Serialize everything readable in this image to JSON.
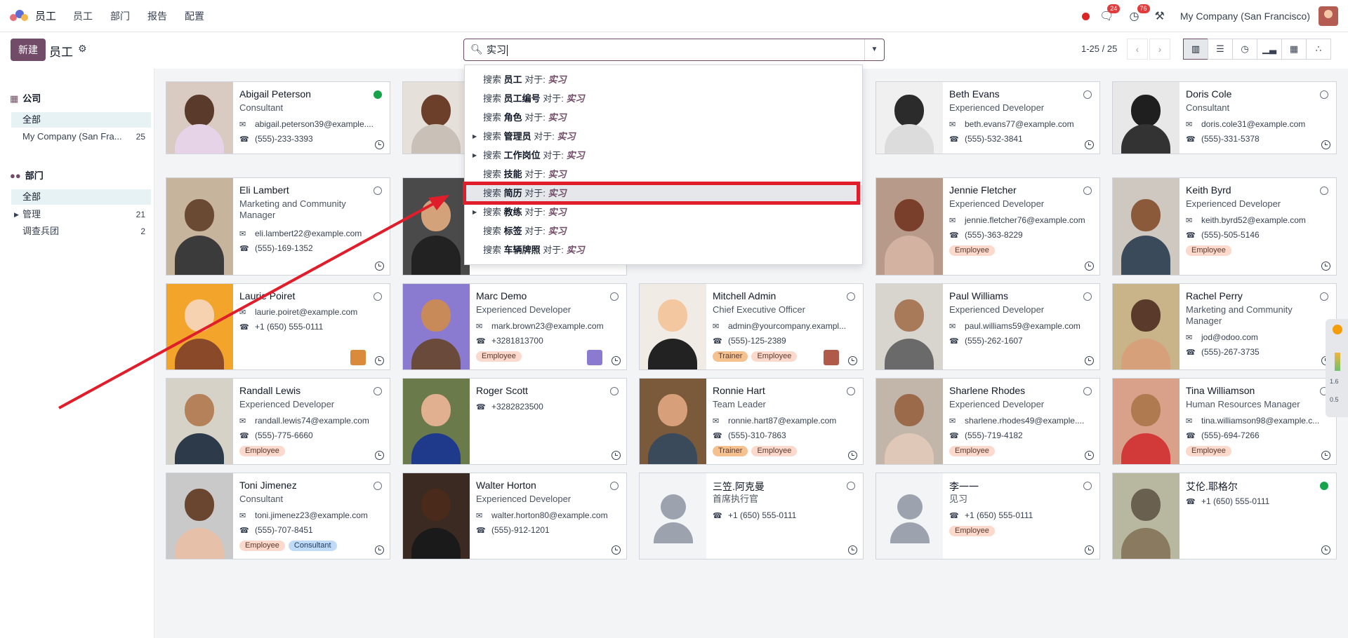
{
  "navbar": {
    "app_name": "员工",
    "menus": [
      "员工",
      "部门",
      "报告",
      "配置"
    ],
    "messages_count": "24",
    "activities_count": "76",
    "company": "My Company (San Francisco)"
  },
  "control": {
    "new_button": "新建",
    "breadcrumb": "员工",
    "search_value": "实习",
    "pager": "1-25 / 25"
  },
  "sidebar": {
    "company_header": "公司",
    "company_items": [
      {
        "label": "全部",
        "count": ""
      },
      {
        "label": "My Company (San Fra...",
        "count": "25"
      }
    ],
    "department_header": "部门",
    "department_items": [
      {
        "label": "全部",
        "count": ""
      },
      {
        "label": "管理",
        "count": "21"
      },
      {
        "label": "调查兵团",
        "count": "2"
      }
    ]
  },
  "search_dropdown": {
    "prefix": "搜索",
    "for_text": "对于:",
    "query": "实习",
    "items": [
      {
        "field": "员工",
        "expandable": false
      },
      {
        "field": "员工编号",
        "expandable": false
      },
      {
        "field": "角色",
        "expandable": false
      },
      {
        "field": "管理员",
        "expandable": true
      },
      {
        "field": "工作岗位",
        "expandable": true
      },
      {
        "field": "技能",
        "expandable": false
      },
      {
        "field": "简历",
        "expandable": false
      },
      {
        "field": "教练",
        "expandable": true
      },
      {
        "field": "标签",
        "expandable": false
      },
      {
        "field": "车辆牌照",
        "expandable": false
      }
    ]
  },
  "employees": [
    {
      "name": "Abigail Peterson",
      "job": "Consultant",
      "email": "abigail.peterson39@example....",
      "phone": "(555)-233-3393",
      "tags": [],
      "online": true
    },
    {
      "name": "Beth Evans",
      "job": "Experienced Developer",
      "email": "beth.evans77@example.com",
      "phone": "(555)-532-3841",
      "tags": [],
      "online": false
    },
    {
      "name": "Doris Cole",
      "job": "Consultant",
      "email": "doris.cole31@example.com",
      "phone": "(555)-331-5378",
      "tags": [],
      "online": false
    },
    {
      "name": "Eli Lambert",
      "job": "Marketing and Community Manager",
      "email": "eli.lambert22@example.com",
      "phone": "(555)-169-1352",
      "tags": [],
      "online": false
    },
    {
      "name": "Jennie Fletcher",
      "job": "Experienced Developer",
      "email": "jennie.fletcher76@example.com",
      "phone": "(555)-363-8229",
      "tags": [
        "Employee"
      ],
      "online": false
    },
    {
      "name": "Keith Byrd",
      "job": "Experienced Developer",
      "email": "keith.byrd52@example.com",
      "phone": "(555)-505-5146",
      "tags": [
        "Employee"
      ],
      "online": false
    },
    {
      "name": "Laurie Poiret",
      "job": "",
      "email": "laurie.poiret@example.com",
      "phone": "+1 (650) 555-0111",
      "tags": [],
      "online": false
    },
    {
      "name": "Marc Demo",
      "job": "Experienced Developer",
      "email": "mark.brown23@example.com",
      "phone": "+3281813700",
      "tags": [
        "Employee"
      ],
      "online": false
    },
    {
      "name": "Mitchell Admin",
      "job": "Chief Executive Officer",
      "email": "admin@yourcompany.exampl...",
      "phone": "(555)-125-2389",
      "tags": [
        "Trainer",
        "Employee"
      ],
      "online": false
    },
    {
      "name": "Paul Williams",
      "job": "Experienced Developer",
      "email": "paul.williams59@example.com",
      "phone": "(555)-262-1607",
      "tags": [],
      "online": false
    },
    {
      "name": "Rachel Perry",
      "job": "Marketing and Community Manager",
      "email": "jod@odoo.com",
      "phone": "(555)-267-3735",
      "tags": [],
      "online": false
    },
    {
      "name": "Randall Lewis",
      "job": "Experienced Developer",
      "email": "randall.lewis74@example.com",
      "phone": "(555)-775-6660",
      "tags": [
        "Employee"
      ],
      "online": false
    },
    {
      "name": "Roger Scott",
      "job": "",
      "email": "",
      "phone": "+3282823500",
      "tags": [],
      "online": false
    },
    {
      "name": "Ronnie Hart",
      "job": "Team Leader",
      "email": "ronnie.hart87@example.com",
      "phone": "(555)-310-7863",
      "tags": [
        "Trainer",
        "Employee"
      ],
      "online": false
    },
    {
      "name": "Sharlene Rhodes",
      "job": "Experienced Developer",
      "email": "sharlene.rhodes49@example....",
      "phone": "(555)-719-4182",
      "tags": [
        "Employee"
      ],
      "online": false
    },
    {
      "name": "Tina Williamson",
      "job": "Human Resources Manager",
      "email": "tina.williamson98@example.c...",
      "phone": "(555)-694-7266",
      "tags": [
        "Employee"
      ],
      "online": false
    },
    {
      "name": "Toni Jimenez",
      "job": "Consultant",
      "email": "toni.jimenez23@example.com",
      "phone": "(555)-707-8451",
      "tags": [
        "Employee",
        "Consultant"
      ],
      "online": false
    },
    {
      "name": "Walter Horton",
      "job": "Experienced Developer",
      "email": "walter.horton80@example.com",
      "phone": "(555)-912-1201",
      "tags": [],
      "online": false
    },
    {
      "name": "三笠.阿克曼",
      "job": "首席执行官",
      "email": "",
      "phone": "+1 (650) 555-0111",
      "tags": [],
      "online": false
    },
    {
      "name": "李一一",
      "job": "见习",
      "email": "",
      "phone": "+1 (650) 555-0111",
      "tags": [
        "Employee"
      ],
      "online": false
    },
    {
      "name": "艾伦.耶格尔",
      "job": "",
      "email": "",
      "phone": "+1 (650) 555-0111",
      "tags": [],
      "online": true
    }
  ],
  "widget": {
    "v1": "1.6",
    "v2": "0.5"
  }
}
